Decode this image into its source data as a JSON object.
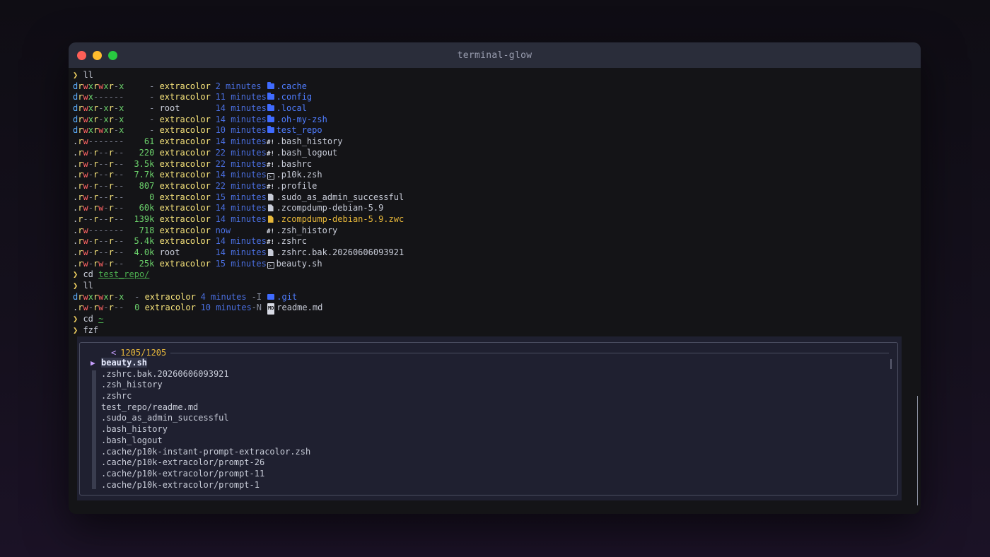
{
  "window": {
    "title": "terminal-glow"
  },
  "colors": {
    "accent": "#f0d060",
    "dir": "#4f7dff",
    "time": "#4a6fe0",
    "size": "#6cd36c",
    "user": "#f5e27a",
    "special": "#e8b83a"
  },
  "terminal": {
    "prompt_symbol": "❯",
    "commands": {
      "ll1": "ll",
      "cd1": "cd",
      "cd1_arg": "test_repo/",
      "ll2": "ll",
      "cd2": "cd",
      "cd2_arg": "~",
      "fzf": "fzf"
    },
    "listing": [
      {
        "perm": [
          "d",
          "r",
          "w",
          "x",
          "r",
          "w",
          "x",
          "r",
          "-",
          "x"
        ],
        "size": "-",
        "user": "extracolor",
        "time": "2 minutes",
        "icon": "folder-icon",
        "name": "cache",
        "dot": ".",
        "kind": "dir"
      },
      {
        "perm": [
          "d",
          "r",
          "w",
          "x",
          "-",
          "-",
          "-",
          "-",
          "-",
          "-"
        ],
        "size": "-",
        "user": "extracolor",
        "time": "11 minutes",
        "icon": "gear-folder-icon",
        "name": "config",
        "dot": ".",
        "kind": "dir"
      },
      {
        "perm": [
          "d",
          "r",
          "w",
          "x",
          "r",
          "-",
          "x",
          "r",
          "-",
          "x"
        ],
        "size": "-",
        "user": "root",
        "time": "14 minutes",
        "icon": "folder-icon",
        "name": "local",
        "dot": ".",
        "kind": "dir"
      },
      {
        "perm": [
          "d",
          "r",
          "w",
          "x",
          "r",
          "-",
          "x",
          "r",
          "-",
          "x"
        ],
        "size": "-",
        "user": "extracolor",
        "time": "14 minutes",
        "icon": "folder-icon",
        "name": "oh-my-zsh",
        "dot": ".",
        "kind": "dir"
      },
      {
        "perm": [
          "d",
          "r",
          "w",
          "x",
          "r",
          "w",
          "x",
          "r",
          "-",
          "x"
        ],
        "size": "-",
        "user": "extracolor",
        "time": "10 minutes",
        "icon": "folder-icon",
        "name": "test_repo",
        "dot": "",
        "kind": "dir"
      },
      {
        "perm": [
          ".",
          "r",
          "w",
          "-",
          "-",
          "-",
          "-",
          "-",
          "-",
          "-"
        ],
        "size": "61",
        "user": "extracolor",
        "time": "14 minutes",
        "icon": "shebang-icon",
        "name": "bash_history",
        "dot": ".",
        "kind": "file"
      },
      {
        "perm": [
          ".",
          "r",
          "w",
          "-",
          "r",
          "-",
          "-",
          "r",
          "-",
          "-"
        ],
        "size": "220",
        "user": "extracolor",
        "time": "22 minutes",
        "icon": "shebang-icon",
        "name": "bash_logout",
        "dot": ".",
        "kind": "file"
      },
      {
        "perm": [
          ".",
          "r",
          "w",
          "-",
          "r",
          "-",
          "-",
          "r",
          "-",
          "-"
        ],
        "size": "3.5k",
        "user": "extracolor",
        "time": "22 minutes",
        "icon": "shebang-icon",
        "name": "bashrc",
        "dot": ".",
        "kind": "file"
      },
      {
        "perm": [
          ".",
          "r",
          "w",
          "-",
          "r",
          "-",
          "-",
          "r",
          "-",
          "-"
        ],
        "size": "7.7k",
        "user": "extracolor",
        "time": "14 minutes",
        "icon": "terminal-icon",
        "name": "p10k.zsh",
        "dot": ".",
        "kind": "file"
      },
      {
        "perm": [
          ".",
          "r",
          "w",
          "-",
          "r",
          "-",
          "-",
          "r",
          "-",
          "-"
        ],
        "size": "807",
        "user": "extracolor",
        "time": "22 minutes",
        "icon": "shebang-icon",
        "name": "profile",
        "dot": ".",
        "kind": "file"
      },
      {
        "perm": [
          ".",
          "r",
          "w",
          "-",
          "r",
          "-",
          "-",
          "r",
          "-",
          "-"
        ],
        "size": "0",
        "user": "extracolor",
        "time": "15 minutes",
        "icon": "file-icon",
        "name": "sudo_as_admin_successful",
        "dot": ".",
        "kind": "file"
      },
      {
        "perm": [
          ".",
          "r",
          "w",
          "-",
          "r",
          "w",
          "-",
          "r",
          "-",
          "-"
        ],
        "size": "60k",
        "user": "extracolor",
        "time": "14 minutes",
        "icon": "file-icon",
        "name": "zcompdump-debian-5.9",
        "dot": ".",
        "kind": "file"
      },
      {
        "perm": [
          ".",
          "r",
          "-",
          "-",
          "r",
          "-",
          "-",
          "r",
          "-",
          "-"
        ],
        "size": "139k",
        "user": "extracolor",
        "time": "14 minutes",
        "icon": "file-yellow-icon",
        "name": "zcompdump-debian-5.9.zwc",
        "dot": ".",
        "kind": "special"
      },
      {
        "perm": [
          ".",
          "r",
          "w",
          "-",
          "-",
          "-",
          "-",
          "-",
          "-",
          "-"
        ],
        "size": "718",
        "user": "extracolor",
        "time": "now",
        "icon": "shebang-icon",
        "name": "zsh_history",
        "dot": ".",
        "kind": "file"
      },
      {
        "perm": [
          ".",
          "r",
          "w",
          "-",
          "r",
          "-",
          "-",
          "r",
          "-",
          "-"
        ],
        "size": "5.4k",
        "user": "extracolor",
        "time": "14 minutes",
        "icon": "shebang-icon",
        "name": "zshrc",
        "dot": ".",
        "kind": "file"
      },
      {
        "perm": [
          ".",
          "r",
          "w",
          "-",
          "r",
          "-",
          "-",
          "r",
          "-",
          "-"
        ],
        "size": "4.0k",
        "user": "root",
        "time": "14 minutes",
        "icon": "file-icon",
        "name": "zshrc.bak.20260606093921",
        "dot": ".",
        "kind": "file"
      },
      {
        "perm": [
          ".",
          "r",
          "w",
          "-",
          "r",
          "w",
          "-",
          "r",
          "-",
          "-"
        ],
        "size": "25k",
        "user": "extracolor",
        "time": "15 minutes",
        "icon": "terminal-icon",
        "name": "beauty.sh",
        "dot": "",
        "kind": "file"
      }
    ],
    "listing2": [
      {
        "perm": [
          "d",
          "r",
          "w",
          "x",
          "r",
          "w",
          "x",
          "r",
          "-",
          "x"
        ],
        "size": "-",
        "user": "extracolor",
        "time": "4 minutes",
        "flag": "-I",
        "icon": "git-folder-icon",
        "name": ".git",
        "kind": "dir"
      },
      {
        "perm": [
          ".",
          "r",
          "w",
          "-",
          "r",
          "w",
          "-",
          "r",
          "-",
          "-"
        ],
        "size": "0",
        "user": "extracolor",
        "time": "10 minutes",
        "flag": "-N",
        "icon": "markdown-icon",
        "name": "readme.md",
        "kind": "file"
      }
    ]
  },
  "fzf": {
    "prompt": "<",
    "count": "1205/1205",
    "pointer": "▶",
    "items": [
      "beauty.sh",
      ".zshrc.bak.20260606093921",
      ".zsh_history",
      ".zshrc",
      "test_repo/readme.md",
      ".sudo_as_admin_successful",
      ".bash_history",
      ".bash_logout",
      ".cache/p10k-instant-prompt-extracolor.zsh",
      ".cache/p10k-extracolor/prompt-26",
      ".cache/p10k-extracolor/prompt-11",
      ".cache/p10k-extracolor/prompt-1"
    ]
  }
}
